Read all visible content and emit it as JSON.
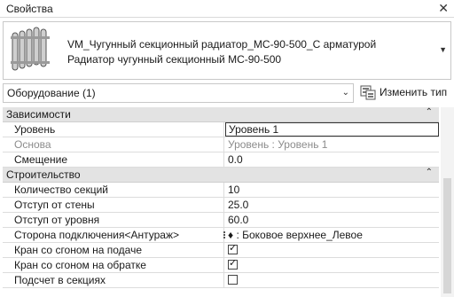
{
  "title": "Свойства",
  "type_selector": {
    "family": "VM_Чугунный секционный радиатор_МС-90-500_С арматурой",
    "type": "Радиатор чугунный секционный МС-90-500"
  },
  "filter": {
    "label": "Оборудование (1)",
    "edit_type_label": "Изменить тип"
  },
  "groups": [
    {
      "name": "Зависимости",
      "rows": [
        {
          "name": "Уровень",
          "value": "Уровень 1",
          "active": true
        },
        {
          "name": "Основа",
          "value": "Уровень : Уровень 1",
          "disabled": true
        },
        {
          "name": "Смещение",
          "value": "0.0"
        }
      ]
    },
    {
      "name": "Строительство",
      "rows": [
        {
          "name": "Количество секций",
          "value": "10"
        },
        {
          "name": "Отступ от стены",
          "value": "25.0"
        },
        {
          "name": "Отступ от уровня",
          "value": "60.0"
        },
        {
          "name": "Сторона подключения<Антураж>",
          "value": "♦ : Боковое верхнее_Левое"
        },
        {
          "name": "Кран со сгоном на подаче",
          "checkbox": true,
          "checked": true
        },
        {
          "name": "Кран со сгоном на обратке",
          "checkbox": true,
          "checked": true
        },
        {
          "name": "Подсчет в секциях",
          "checkbox": true,
          "checked": false
        }
      ]
    }
  ]
}
